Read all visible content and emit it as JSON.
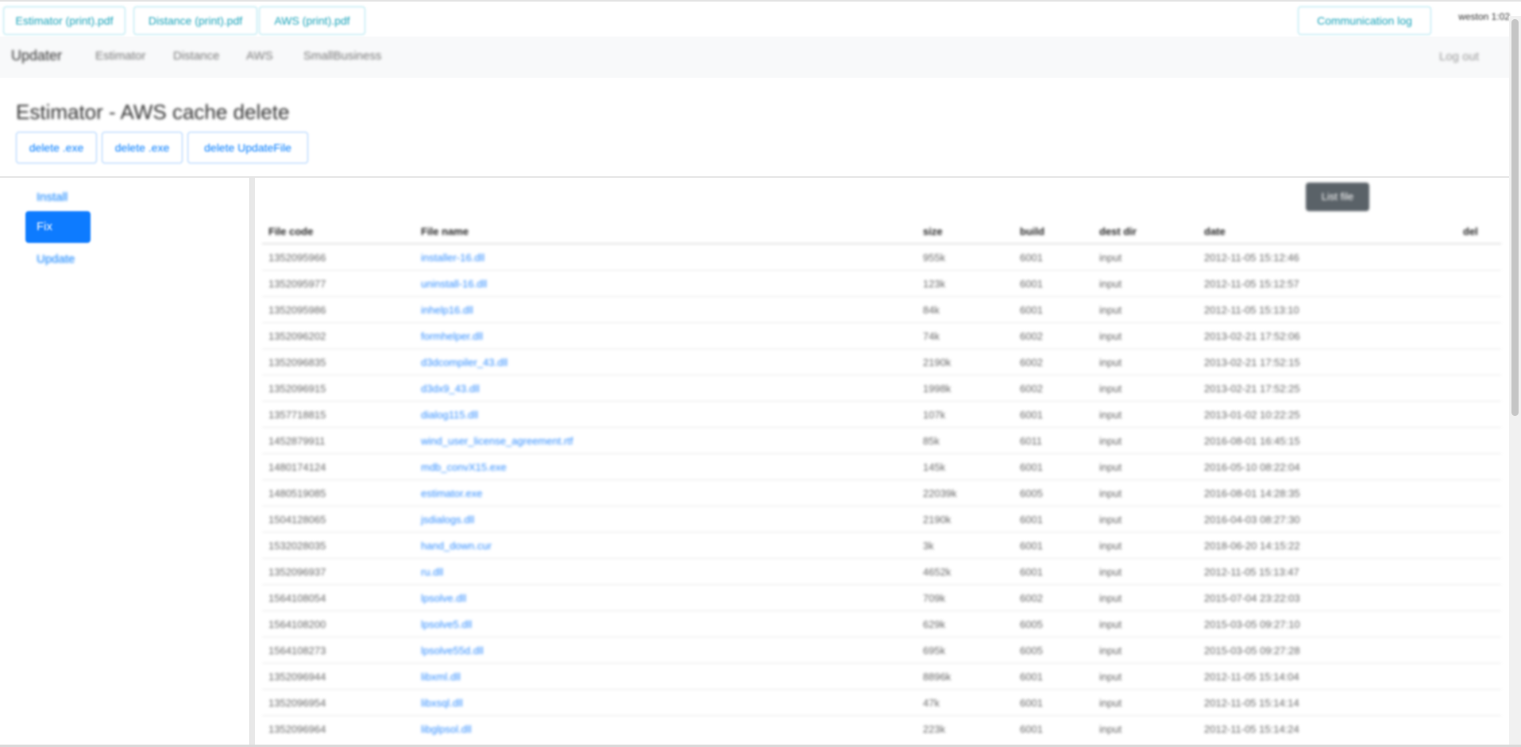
{
  "top_buttons": [
    "Estimator (print).pdf",
    "Distance (print).pdf",
    "AWS (print).pdf"
  ],
  "top_right_button": "Communication log",
  "user_text": "weston  1:02",
  "nav": {
    "brand": "Updater",
    "items": [
      "Estimator",
      "Distance",
      "AWS",
      "SmallBusiness"
    ],
    "logout": "Log out"
  },
  "page_title": "Estimator - AWS cache delete",
  "header_buttons": [
    "delete .exe",
    "delete .exe",
    "delete UpdateFile"
  ],
  "sidebar": {
    "items": [
      "Install",
      "Fix",
      "Update"
    ],
    "active_index": 1
  },
  "list_button": "List file",
  "table": {
    "headers": [
      "File code",
      "File name",
      "size",
      "build",
      "dest dir",
      "date",
      "del"
    ],
    "rows": [
      [
        "1352095966",
        "installer-16.dll",
        "955k",
        "6001",
        "input",
        "2012-11-05 15:12:46",
        ""
      ],
      [
        "1352095977",
        "uninstall-16.dll",
        "123k",
        "6001",
        "input",
        "2012-11-05 15:12:57",
        ""
      ],
      [
        "1352095986",
        "inhelp16.dll",
        "84k",
        "6001",
        "input",
        "2012-11-05 15:13:10",
        ""
      ],
      [
        "1352096202",
        "formhelper.dll",
        "74k",
        "6002",
        "input",
        "2013-02-21 17:52:06",
        ""
      ],
      [
        "1352096835",
        "d3dcompiler_43.dll",
        "2190k",
        "6002",
        "input",
        "2013-02-21 17:52:15",
        ""
      ],
      [
        "1352096915",
        "d3dx9_43.dll",
        "1998k",
        "6002",
        "input",
        "2013-02-21 17:52:25",
        ""
      ],
      [
        "1357718815",
        "dialog115.dll",
        "107k",
        "6001",
        "input",
        "2013-01-02 10:22:25",
        ""
      ],
      [
        "1452879911",
        "wind_user_license_agreement.rtf",
        "85k",
        "6011",
        "input",
        "2016-08-01 16:45:15",
        ""
      ],
      [
        "1480174124",
        "mdb_convX15.exe",
        "145k",
        "6001",
        "input",
        "2016-05-10 08:22:04",
        ""
      ],
      [
        "1480519085",
        "estimator.exe",
        "22039k",
        "6005",
        "input",
        "2016-08-01 14:28:35",
        ""
      ],
      [
        "1504128065",
        "jsdialogs.dll",
        "2190k",
        "6001",
        "input",
        "2016-04-03 08:27:30",
        ""
      ],
      [
        "1532028035",
        "hand_down.cur",
        "3k",
        "6001",
        "input",
        "2018-06-20 14:15:22",
        ""
      ],
      [
        "1352096937",
        "ru.dll",
        "4652k",
        "6001",
        "input",
        "2012-11-05 15:13:47",
        ""
      ],
      [
        "1564108054",
        "lpsolve.dll",
        "709k",
        "6002",
        "input",
        "2015-07-04 23:22:03",
        ""
      ],
      [
        "1564108200",
        "lpsolve5.dll",
        "629k",
        "6005",
        "input",
        "2015-03-05 09:27:10",
        ""
      ],
      [
        "1564108273",
        "lpsolve55d.dll",
        "695k",
        "6005",
        "input",
        "2015-03-05 09:27:28",
        ""
      ],
      [
        "1352096944",
        "libxml.dll",
        "8896k",
        "6001",
        "input",
        "2012-11-05 15:14:04",
        ""
      ],
      [
        "1352096954",
        "libxsql.dll",
        "47k",
        "6001",
        "input",
        "2012-11-05 15:14:14",
        ""
      ],
      [
        "1352096964",
        "libglpsol.dll",
        "223k",
        "6001",
        "input",
        "2012-11-05 15:14:24",
        ""
      ]
    ]
  }
}
